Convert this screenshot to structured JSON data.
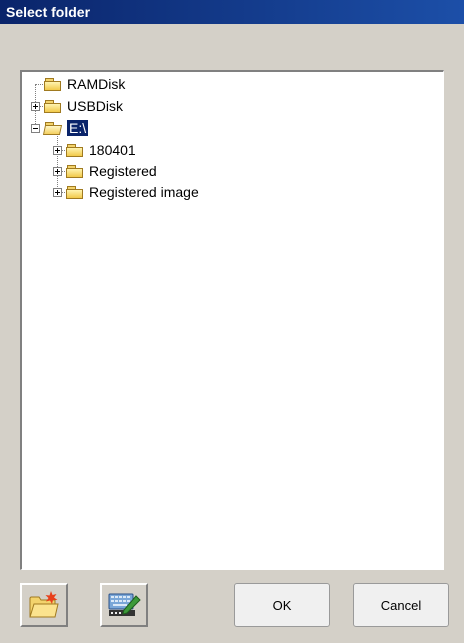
{
  "window": {
    "title": "Select folder"
  },
  "tree": {
    "nodes": [
      {
        "label": "RAMDisk",
        "expander": "none"
      },
      {
        "label": "USBDisk",
        "expander": "plus"
      },
      {
        "label": "E:\\",
        "expander": "minus",
        "selected": true
      },
      {
        "label": "180401",
        "expander": "plus"
      },
      {
        "label": "Registered",
        "expander": "plus"
      },
      {
        "label": "Registered image",
        "expander": "plus"
      }
    ]
  },
  "buttons": {
    "new_folder_icon": "new-folder-icon",
    "keyboard_icon": "keyboard-edit-icon",
    "ok_label": "OK",
    "cancel_label": "Cancel"
  },
  "colors": {
    "title_bar": "#0a246a",
    "selection": "#0a246a",
    "folder": "#f1c94a"
  }
}
